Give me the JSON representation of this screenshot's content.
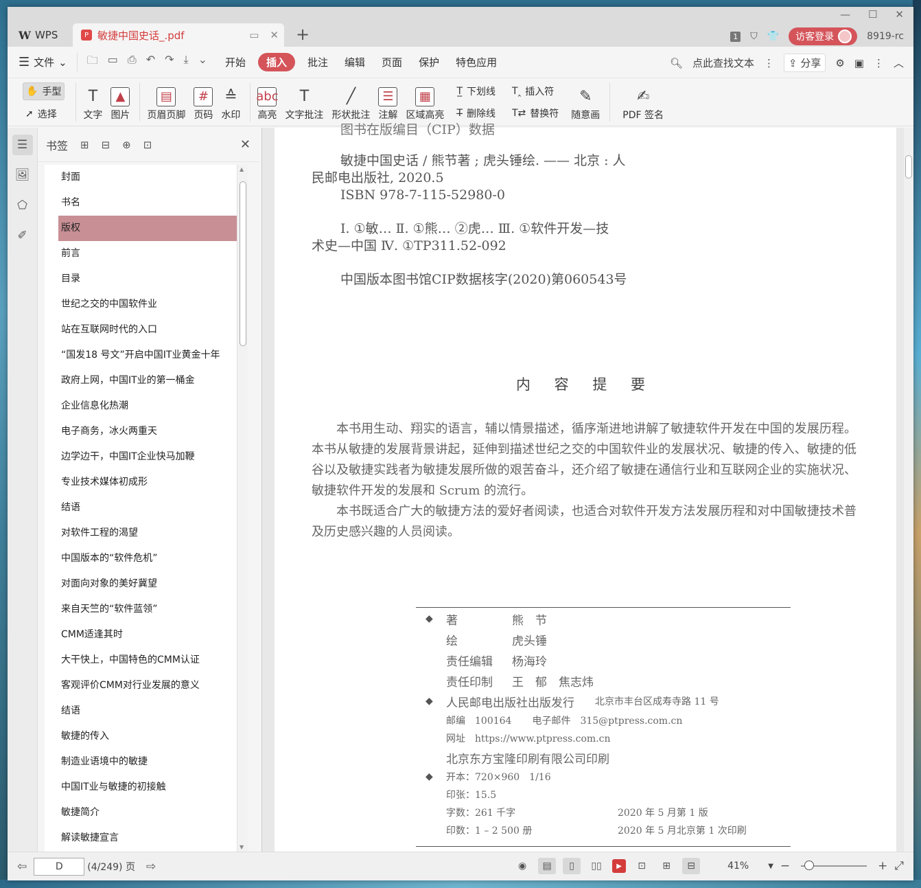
{
  "window": {
    "wps_label": "WPS",
    "tab_title": "敏捷中国史话_.pdf",
    "tab_count": "1",
    "login_label": "访客登录",
    "user_id": "8919-rc"
  },
  "menubar": {
    "file_label": "文件",
    "items": [
      "开始",
      "插入",
      "批注",
      "编辑",
      "页面",
      "保护",
      "特色应用"
    ],
    "active": "插入",
    "search_label": "点此查找文本",
    "share_label": "分享"
  },
  "toolbar": {
    "hand_label": "手型",
    "select_label": "选择",
    "text_label": "文字",
    "image_label": "图片",
    "header_footer_label": "页眉页脚",
    "page_num_label": "页码",
    "watermark_label": "水印",
    "highlight_label": "高亮",
    "text_comment_label": "文字批注",
    "shape_comment_label": "形状批注",
    "annotation_label": "注解",
    "area_highlight_label": "区域高亮",
    "underline_label": "下划线",
    "strike_label": "删除线",
    "insert_char_label": "插入符",
    "replace_char_label": "替换符",
    "freehand_label": "随意画",
    "pdf_sign_label": "PDF 签名"
  },
  "bookmarks": {
    "title": "书签",
    "selected_index": 2,
    "items": [
      "封面",
      "书名",
      "版权",
      "前言",
      "目录",
      "世纪之交的中国软件业",
      "站在互联网时代的入口",
      "“国发18 号文”开启中国IT业黄金十年",
      "政府上网，中国IT业的第一桶金",
      "企业信息化热潮",
      "电子商务，冰火两重天",
      "边学边干，中国IT企业快马加鞭",
      "专业技术媒体初成形",
      "结语",
      "对软件工程的渴望",
      "中国版本的“软件危机”",
      "对面向对象的美好冀望",
      "来自天竺的“软件蓝领”",
      "CMM适逢其时",
      "大干快上，中国特色的CMM认证",
      "客观评价CMM对行业发展的意义",
      "结语",
      "敏捷的传入",
      "制造业语境中的敏捷",
      "中国IT业与敏捷的初接触",
      "敏捷简介",
      "解读敏捷宣言"
    ]
  },
  "document": {
    "cip_partial": "图书在版编目（CIP）数据",
    "cip_line1": "敏捷中国史话 / 熊节著 ; 虎头锤绘. —— 北京 : 人",
    "cip_line2": "民邮电出版社, 2020.5",
    "cip_line3": "ISBN 978-7-115-52980-0",
    "cip_line4": "Ⅰ. ①敏… Ⅱ. ①熊… ②虎… Ⅲ. ①软件开发—技",
    "cip_line5": "术史—中国 Ⅳ. ①TP311.52-092",
    "cip_line6": "中国版本图书馆CIP数据核字(2020)第060543号",
    "summary_title": "内 容 提 要",
    "summary_p1": "本书用生动、翔实的语言，辅以情景描述，循序渐进地讲解了敏捷软件开发在中国的发展历程。本书从敏捷的发展背景讲起，延伸到描述世纪之交的中国软件业的发展状况、敏捷的传入、敏捷的低谷以及敏捷实践者为敏捷发展所做的艰苦奋斗，还介绍了敏捷在通信行业和互联网企业的实施状况、敏捷软件开发的发展和 Scrum 的流行。",
    "summary_p2": "本书既适合广大的敏捷方法的爱好者阅读，也适合对软件开发方法发展历程和对中国敏捷技术普及历史感兴趣的人员阅读。",
    "colophon": {
      "author_label": "著",
      "author": "熊　节",
      "illus_label": "绘",
      "illus": "虎头锤",
      "editor_label": "责任编辑",
      "editor": "杨海玲",
      "print_label": "责任印制",
      "print": "王　郁　焦志炜",
      "publisher": "人民邮电出版社出版发行",
      "address": "北京市丰台区成寿寺路 11 号",
      "postcode": "邮编　100164",
      "email": "电子邮件　315@ptpress.com.cn",
      "website": "网址　https://www.ptpress.com.cn",
      "printer": "北京东方宝隆印刷有限公司印刷",
      "format": "开本：720×960　1/16",
      "sheets": "印张：15.5",
      "words": "字数：261 千字",
      "edition": "2020 年 5 月第 1 版",
      "copies": "印数：1 – 2 500 册",
      "printing": "2020 年 5 月北京第 1 次印刷"
    }
  },
  "statusbar": {
    "page_value": "D",
    "page_info": "(4/249) 页",
    "zoom": "41%",
    "zoom_fraction": 0.05
  }
}
